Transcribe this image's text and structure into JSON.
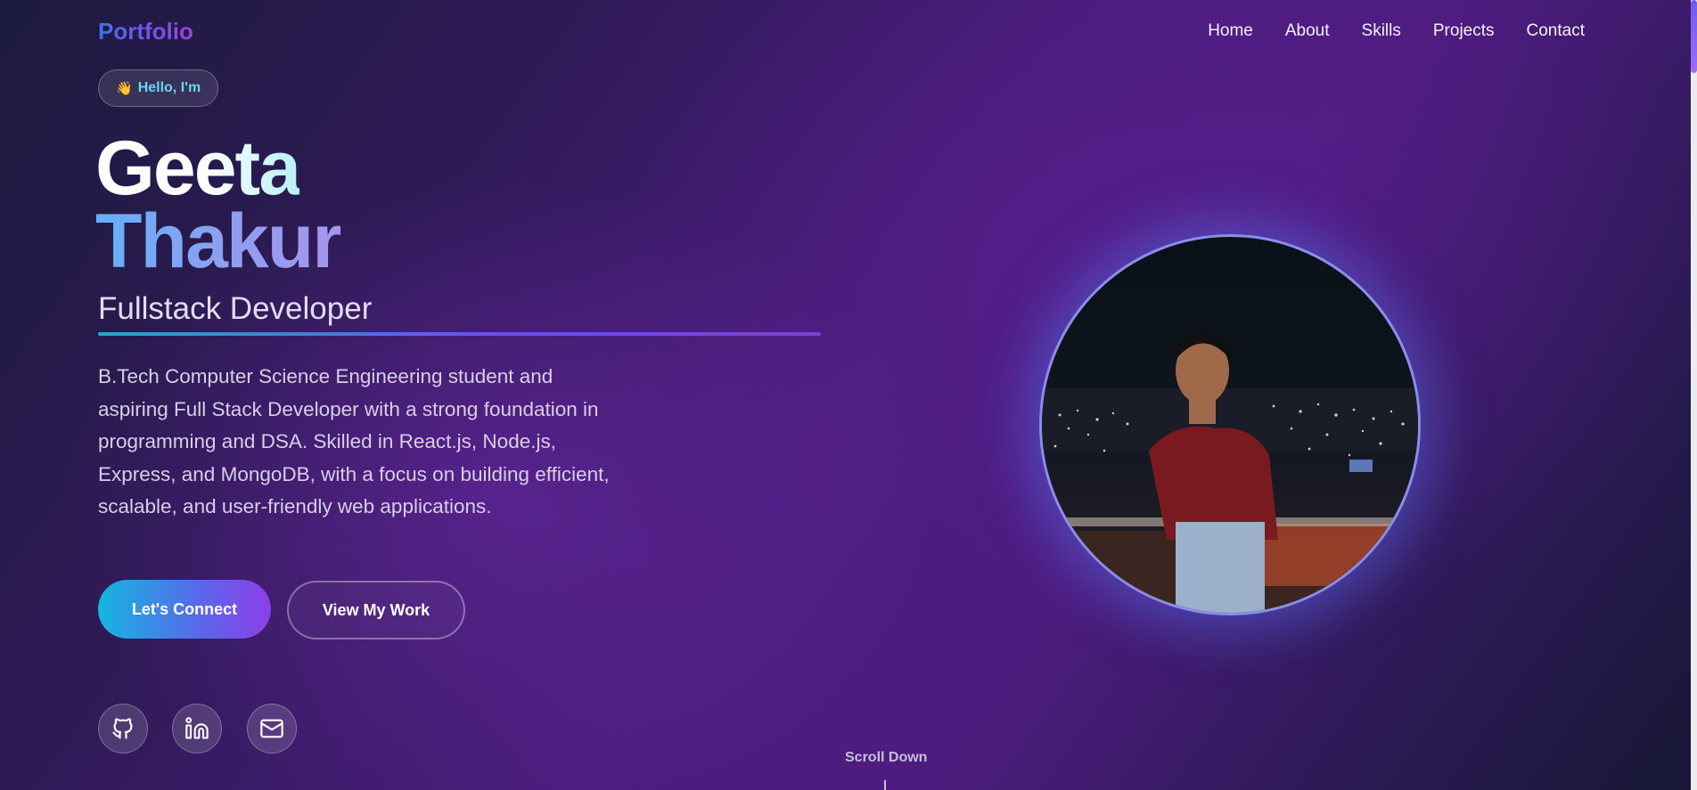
{
  "nav": {
    "logo": "Portfolio",
    "links": [
      "Home",
      "About",
      "Skills",
      "Projects",
      "Contact"
    ]
  },
  "hero": {
    "greeting_icon": "👋",
    "greeting": "Hello, I'm",
    "first_name": "Geeta",
    "last_name": "Thakur",
    "role": "Fullstack Developer",
    "bio": "B.Tech Computer Science Engineering student and aspiring Full Stack Developer with a strong foundation in programming and DSA. Skilled in React.js, Node.js, Express, and MongoDB, with a focus on building efficient, scalable, and user-friendly web applications.",
    "primary_button": "Let's Connect",
    "secondary_button": "View My Work",
    "socials": [
      "github-icon",
      "linkedin-icon",
      "email-icon"
    ],
    "scroll_hint": "Scroll Down"
  },
  "colors": {
    "accent_cyan": "#15b6e0",
    "accent_purple": "#8e3ee8",
    "logo_blue": "#3f6ff2"
  }
}
